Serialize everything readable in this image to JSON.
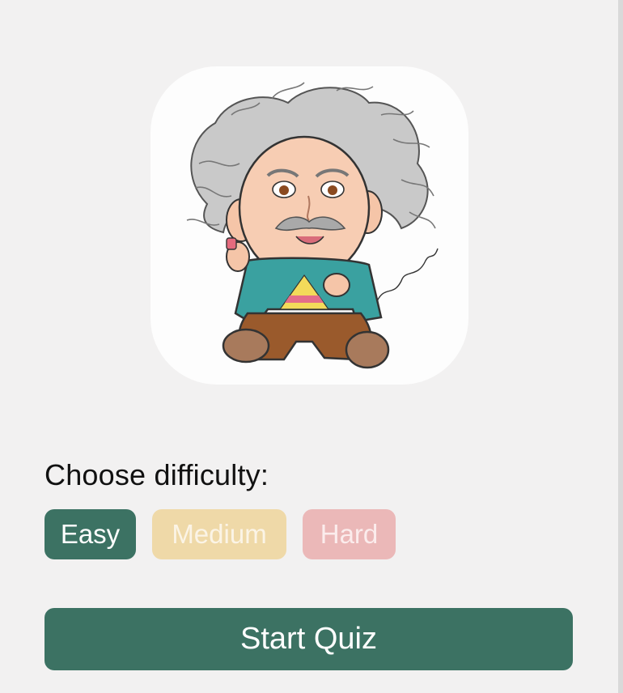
{
  "colors": {
    "background": "#f2f1f1",
    "accent": "#3c7263",
    "easy": "#3c7263",
    "medium": "#efd9a8",
    "hard": "#ebb8b8"
  },
  "mascot": {
    "icon": "einstein-cartoon-mascot"
  },
  "difficulty": {
    "heading": "Choose difficulty:",
    "options": [
      "Easy",
      "Medium",
      "Hard"
    ],
    "selected": "Easy"
  },
  "start_button": {
    "label": "Start Quiz"
  }
}
